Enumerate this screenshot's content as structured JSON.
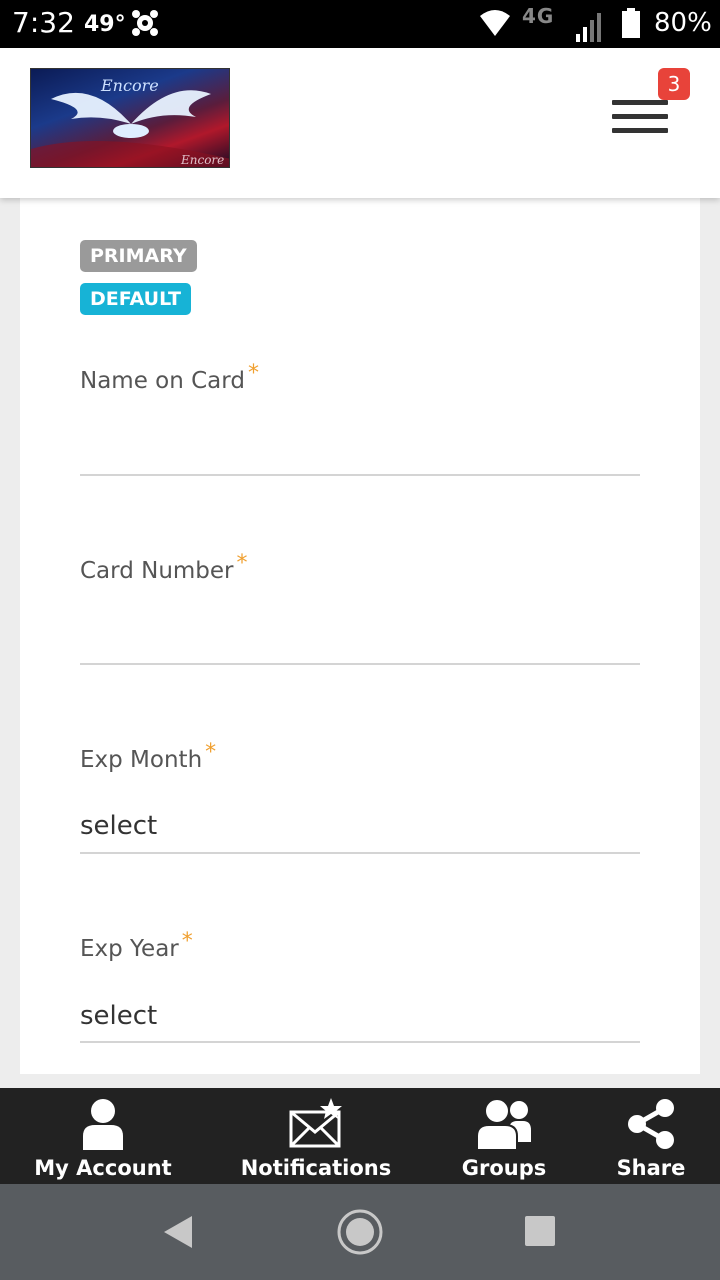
{
  "status_bar": {
    "time": "7:32",
    "temperature": "49°",
    "network": "4G",
    "battery_percent": "80%",
    "battery_level": 0.8
  },
  "header": {
    "logo_text": "Encore",
    "notification_count": "3"
  },
  "card": {
    "tags": [
      "PRIMARY",
      "DEFAULT"
    ],
    "required_marker": "*",
    "fields": [
      {
        "label": "Name on Card",
        "value": ""
      },
      {
        "label": "Card Number",
        "value": ""
      },
      {
        "label": "Exp Month",
        "value": "select"
      },
      {
        "label": "Exp Year",
        "value": "select"
      }
    ]
  },
  "bottom_nav": {
    "items": [
      {
        "label": "My Account",
        "icon": "user-icon"
      },
      {
        "label": "Notifications",
        "icon": "mail-star-icon"
      },
      {
        "label": "Groups",
        "icon": "group-icon"
      },
      {
        "label": "Share",
        "icon": "share-icon"
      }
    ]
  },
  "system_nav": {
    "icons": [
      "back-icon",
      "home-icon",
      "recents-icon"
    ]
  },
  "colors": {
    "badge": "#e8433a",
    "primary_tag": "#9a9a9a",
    "default_tag": "#17b3d6",
    "required": "#f0a030",
    "nav_bg": "#222222"
  }
}
